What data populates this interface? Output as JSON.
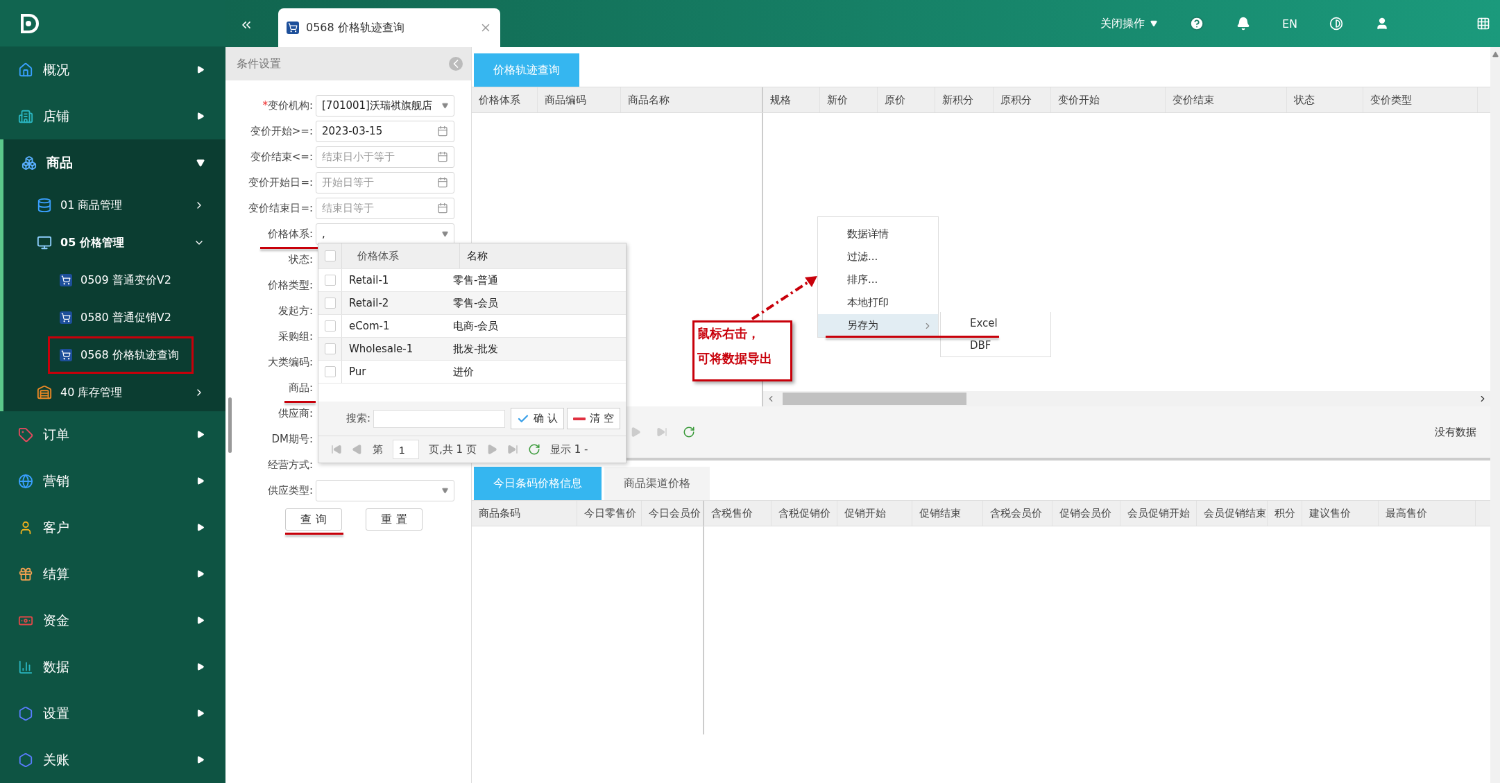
{
  "topbar": {
    "tabs": [
      {
        "label": "0568 价格轨迹查询",
        "selected": true
      }
    ],
    "close_ops": "关闭操作",
    "lang": "EN"
  },
  "sidebar": {
    "items": [
      {
        "label": "概况",
        "kind": "home",
        "expanded": false
      },
      {
        "label": "店铺",
        "kind": "building",
        "expanded": false
      },
      {
        "label": "商品",
        "kind": "cubes",
        "expanded": true,
        "children": [
          {
            "label": "01 商品管理",
            "kind": "database",
            "expanded": false
          },
          {
            "label": "05 价格管理",
            "kind": "monitor",
            "expanded": true,
            "children": [
              {
                "label": "0509 普通变价V2"
              },
              {
                "label": "0580 普通促销V2"
              },
              {
                "label": "0568 价格轨迹查询",
                "marked": true
              }
            ]
          },
          {
            "label": "40 库存管理",
            "kind": "warehouse",
            "expanded": false
          }
        ]
      },
      {
        "label": "订单",
        "kind": "sale",
        "expanded": false
      },
      {
        "label": "营销",
        "kind": "globe",
        "expanded": false
      },
      {
        "label": "客户",
        "kind": "user",
        "expanded": false
      },
      {
        "label": "结算",
        "kind": "gift",
        "expanded": false
      },
      {
        "label": "资金",
        "kind": "money",
        "expanded": false
      },
      {
        "label": "数据",
        "kind": "data",
        "expanded": false
      },
      {
        "label": "设置",
        "kind": "hexagon",
        "expanded": false
      },
      {
        "label": "关账",
        "kind": "hexagon",
        "expanded": false
      }
    ]
  },
  "conditions": {
    "title": "条件设置",
    "fields": [
      {
        "label": "变价机构:",
        "required": "*",
        "kind": "select",
        "value": "[701001]沃瑞祺旗舰店"
      },
      {
        "label": "变价开始>=:",
        "kind": "date",
        "value": "2023-03-15"
      },
      {
        "label": "变价结束<=:",
        "kind": "date",
        "placeholder": "结束日小于等于"
      },
      {
        "label": "变价开始日=:",
        "kind": "date",
        "placeholder": "开始日等于"
      },
      {
        "label": "变价结束日=:",
        "kind": "date",
        "placeholder": "结束日等于"
      },
      {
        "label": "价格体系:",
        "kind": "select",
        "value": ",",
        "marked": true
      },
      {
        "label": "状态:",
        "kind": "covered"
      },
      {
        "label": "价格类型:",
        "kind": "covered"
      },
      {
        "label": "发起方:",
        "kind": "covered"
      },
      {
        "label": "采购组:",
        "kind": "covered"
      },
      {
        "label": "大类编码:",
        "kind": "covered"
      },
      {
        "label": "商品:",
        "kind": "covered",
        "marked": true
      },
      {
        "label": "供应商:",
        "kind": "covered"
      },
      {
        "label": "DM期号:",
        "kind": "covered"
      },
      {
        "label": "经营方式:",
        "kind": "covered"
      },
      {
        "label": "供应类型:",
        "kind": "select"
      }
    ],
    "buttons": [
      {
        "label": "查 询",
        "marked": true
      },
      {
        "label": "重 置"
      }
    ]
  },
  "dropdown": {
    "columns": [
      "价格体系",
      "名称"
    ],
    "header_checked": false,
    "rows": [
      {
        "code": "Retail-1",
        "name": "零售-普通",
        "checked": false
      },
      {
        "code": "Retail-2",
        "name": "零售-会员",
        "checked": false
      },
      {
        "code": "eCom-1",
        "name": "电商-会员",
        "checked": false
      },
      {
        "code": "Wholesale-1",
        "name": "批发-批发",
        "checked": false
      },
      {
        "code": "Pur",
        "name": "进价",
        "checked": false
      }
    ],
    "search_label": "搜索:",
    "confirm": "确 认",
    "clear": "清 空",
    "pager": {
      "page_prefix": "第",
      "page": "1",
      "page_suffix": "页,共 1 页",
      "display": "显示 1 -"
    }
  },
  "upper": {
    "tabs": [
      {
        "label": "价格轨迹查询",
        "selected": true
      }
    ],
    "columns": [
      "价格体系",
      "商品编码",
      "商品名称",
      "规格",
      "新价",
      "原价",
      "新积分",
      "原积分",
      "变价开始",
      "变价结束",
      "状态",
      "变价类型"
    ],
    "status": "没有数据"
  },
  "context_menu": {
    "items": [
      {
        "label": "数据详情",
        "highlighted": false
      },
      {
        "label": "过滤...",
        "highlighted": false
      },
      {
        "label": "排序...",
        "highlighted": false
      },
      {
        "label": "本地打印",
        "highlighted": false
      },
      {
        "label": "另存为",
        "highlighted": true,
        "submenu": true,
        "marked": true
      }
    ],
    "submenu": [
      {
        "label": "Excel"
      },
      {
        "label": "DBF"
      }
    ]
  },
  "callout": {
    "lines": [
      "鼠标右击，",
      "可将数据导出"
    ]
  },
  "lower": {
    "tabs": [
      {
        "label": "今日条码价格信息",
        "selected": true
      },
      {
        "label": "商品渠道价格",
        "selected": false
      }
    ],
    "columns": [
      "商品条码",
      "今日零售价",
      "今日会员价",
      "含税售价",
      "含税促销价",
      "促销开始",
      "促销结束",
      "含税会员价",
      "促销会员价",
      "会员促销开始",
      "会员促销结束",
      "积分",
      "建议售价",
      "最高售价"
    ]
  }
}
